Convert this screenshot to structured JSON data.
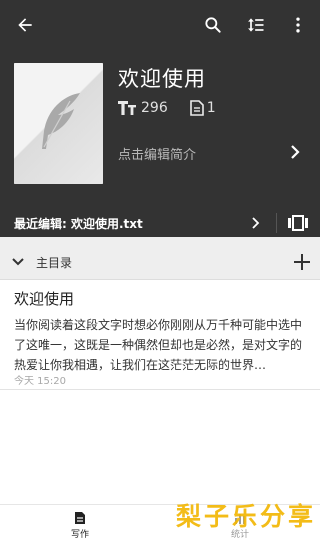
{
  "toolbar": {
    "back_icon": "arrow-back-icon",
    "search_icon": "search-icon",
    "sort_icon": "sort-icon",
    "more_icon": "more-vert-icon"
  },
  "book": {
    "cover_icon": "feather-icon",
    "title": "欢迎使用",
    "word_count": "296",
    "chapter_count": "1",
    "intro_placeholder": "点击编辑简介"
  },
  "recent": {
    "label": "最近编辑: 欢迎使用.txt"
  },
  "directory": {
    "label": "主目录"
  },
  "entries": [
    {
      "title": "欢迎使用",
      "preview": "当你阅读着这段文字时想必你刚刚从万千种可能中选中了这唯一，这既是一种偶然但却也是必然，是对文字的热爱让你我相遇，让我们在这茫茫无际的世界…",
      "time": "今天 15:20"
    }
  ],
  "bottom_nav": {
    "write_label": "写作",
    "stats_label": "统计"
  },
  "watermark": "梨子乐分享",
  "colors": {
    "header_bg": "#333333",
    "accent_watermark": "#f2b705"
  }
}
